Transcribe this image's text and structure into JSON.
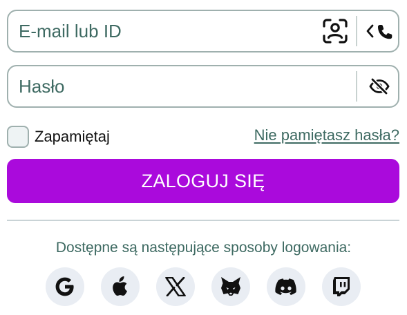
{
  "login_form": {
    "email_field": {
      "placeholder": "E-mail lub ID",
      "scan_icon": "face-scan-icon",
      "phone_icon": "phone-switch-icon"
    },
    "password_field": {
      "placeholder": "Hasło",
      "visibility_icon": "eye-slash-icon"
    },
    "remember_me": {
      "label": "Zapamiętaj",
      "checked": false
    },
    "forgot_password": {
      "label": "Nie pamiętasz hasła?"
    },
    "submit": {
      "label": "ZALOGUJ SIĘ",
      "color": "#aa0adc"
    }
  },
  "alternative_logins": {
    "caption": "Dostępne są następujące sposoby logowania:",
    "providers": [
      {
        "icon": "google-icon"
      },
      {
        "icon": "apple-icon"
      },
      {
        "icon": "x-icon"
      },
      {
        "icon": "metamask-icon"
      },
      {
        "icon": "discord-icon"
      },
      {
        "icon": "twitch-icon"
      }
    ]
  },
  "colors": {
    "text_muted": "#3e6a62",
    "border": "#9fb0ae",
    "social_bg": "#e9edf3"
  }
}
